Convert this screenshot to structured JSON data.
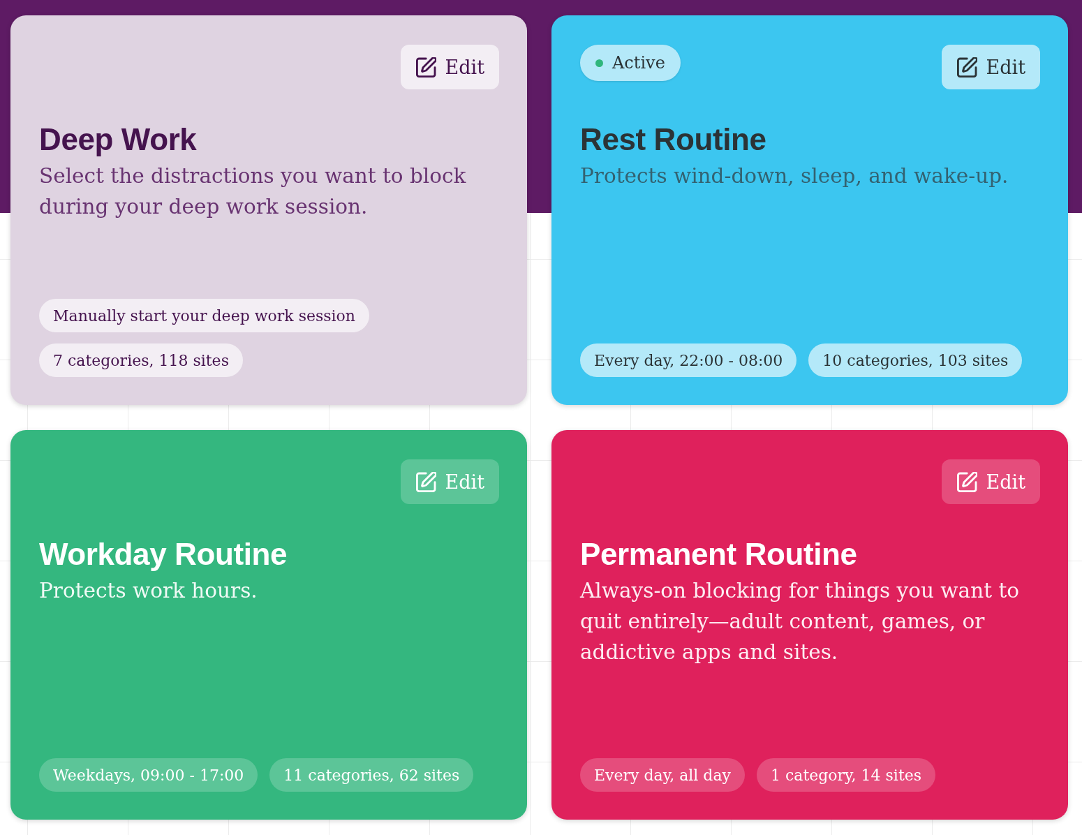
{
  "routines": [
    {
      "title": "Deep Work",
      "description": "Select the distractions you want to block during your deep work session.",
      "color": "#dfd3e1",
      "edit_button": "Edit",
      "tags": [
        "Manually start your deep work session",
        "7 categories, 118 sites"
      ]
    },
    {
      "title": "Rest Routine",
      "description": "Protects wind-down, sleep, and wake-up.",
      "color": "#3cc6f0",
      "status": {
        "label": "Active",
        "color": "#2fb67c"
      },
      "edit_button": "Edit",
      "tags": [
        "Every day, 22:00 - 08:00",
        "10 categories, 103 sites"
      ]
    },
    {
      "title": "Workday Routine",
      "description": "Protects work hours.",
      "color": "#34b77f",
      "edit_button": "Edit",
      "tags": [
        "Weekdays, 09:00 - 17:00",
        "11 categories, 62 sites"
      ]
    },
    {
      "title": "Permanent Routine",
      "description": "Always-on blocking for things you want to quit entirely—adult content, games, or addictive apps and sites.",
      "color": "#df215c",
      "edit_button": "Edit",
      "tags": [
        "Every day, all day",
        "1 category, 14 sites"
      ]
    }
  ]
}
